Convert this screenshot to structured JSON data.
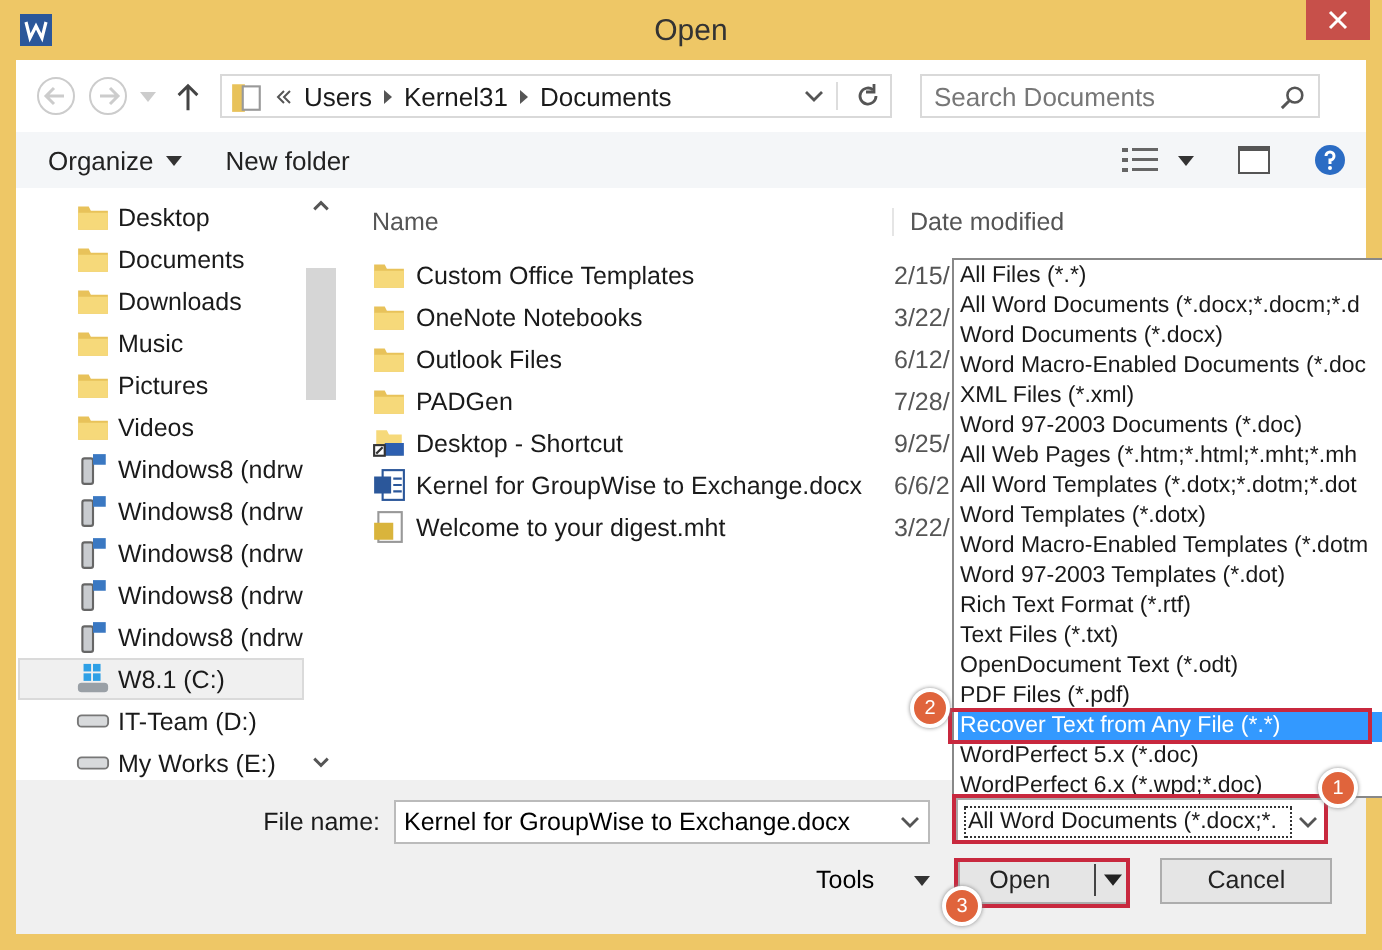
{
  "window": {
    "title": "Open"
  },
  "nav": {
    "path": [
      "Users",
      "Kernel31",
      "Documents"
    ],
    "search": {
      "placeholder": "Search Documents"
    }
  },
  "toolbar": {
    "organize": "Organize",
    "new_folder": "New folder"
  },
  "sidebar": {
    "items": [
      {
        "label": "Desktop",
        "kind": "folder",
        "selected": false
      },
      {
        "label": "Documents",
        "kind": "folder",
        "selected": false
      },
      {
        "label": "Downloads",
        "kind": "folder",
        "selected": false
      },
      {
        "label": "Music",
        "kind": "folder",
        "selected": false
      },
      {
        "label": "Pictures",
        "kind": "folder",
        "selected": false
      },
      {
        "label": "Videos",
        "kind": "folder",
        "selected": false
      },
      {
        "label": "Windows8 (ndrw",
        "kind": "network",
        "selected": false
      },
      {
        "label": "Windows8 (ndrw",
        "kind": "network",
        "selected": false
      },
      {
        "label": "Windows8 (ndrw",
        "kind": "network",
        "selected": false
      },
      {
        "label": "Windows8 (ndrw",
        "kind": "network",
        "selected": false
      },
      {
        "label": "Windows8 (ndrw",
        "kind": "network",
        "selected": false
      },
      {
        "label": "W8.1 (C:)",
        "kind": "system-drive",
        "selected": true
      },
      {
        "label": "IT-Team (D:)",
        "kind": "drive",
        "selected": false
      },
      {
        "label": "My Works (E:)",
        "kind": "drive",
        "selected": false
      }
    ]
  },
  "files": {
    "columns": [
      "Name",
      "Date modified"
    ],
    "rows": [
      {
        "name": "Custom Office Templates",
        "kind": "folder",
        "date": "2/15/"
      },
      {
        "name": "OneNote Notebooks",
        "kind": "folder",
        "date": "3/22/"
      },
      {
        "name": "Outlook Files",
        "kind": "folder",
        "date": "6/12/"
      },
      {
        "name": "PADGen",
        "kind": "folder",
        "date": "7/28/"
      },
      {
        "name": "Desktop - Shortcut",
        "kind": "shortcut",
        "date": "9/25/"
      },
      {
        "name": "Kernel for GroupWise to Exchange.docx",
        "kind": "word",
        "date": "6/6/2"
      },
      {
        "name": "Welcome to your digest.mht",
        "kind": "mht",
        "date": "3/22/"
      }
    ]
  },
  "type_list": {
    "items": [
      {
        "label": "All Files (*.*)",
        "selected": false
      },
      {
        "label": "All Word Documents (*.docx;*.docm;*.d",
        "selected": false
      },
      {
        "label": "Word Documents (*.docx)",
        "selected": false
      },
      {
        "label": "Word Macro-Enabled Documents (*.doc",
        "selected": false
      },
      {
        "label": "XML Files (*.xml)",
        "selected": false
      },
      {
        "label": "Word 97-2003 Documents (*.doc)",
        "selected": false
      },
      {
        "label": "All Web Pages (*.htm;*.html;*.mht;*.mh",
        "selected": false
      },
      {
        "label": "All Word Templates (*.dotx;*.dotm;*.dot",
        "selected": false
      },
      {
        "label": "Word Templates (*.dotx)",
        "selected": false
      },
      {
        "label": "Word Macro-Enabled Templates (*.dotm",
        "selected": false
      },
      {
        "label": "Word 97-2003 Templates (*.dot)",
        "selected": false
      },
      {
        "label": "Rich Text Format (*.rtf)",
        "selected": false
      },
      {
        "label": "Text Files (*.txt)",
        "selected": false
      },
      {
        "label": "OpenDocument Text (*.odt)",
        "selected": false
      },
      {
        "label": "PDF Files (*.pdf)",
        "selected": false
      },
      {
        "label": "Recover Text from Any File (*.*)",
        "selected": true
      },
      {
        "label": "WordPerfect 5.x (*.doc)",
        "selected": false
      },
      {
        "label": "WordPerfect 6.x (*.wpd;*.doc)",
        "selected": false
      }
    ]
  },
  "file_name": {
    "label": "File name:",
    "value": "Kernel for GroupWise to Exchange.docx"
  },
  "file_type": {
    "value": "All Word Documents (*.docx;*."
  },
  "tools": "Tools",
  "buttons": {
    "open": "Open",
    "cancel": "Cancel"
  },
  "annotations": [
    "1",
    "2",
    "3"
  ]
}
